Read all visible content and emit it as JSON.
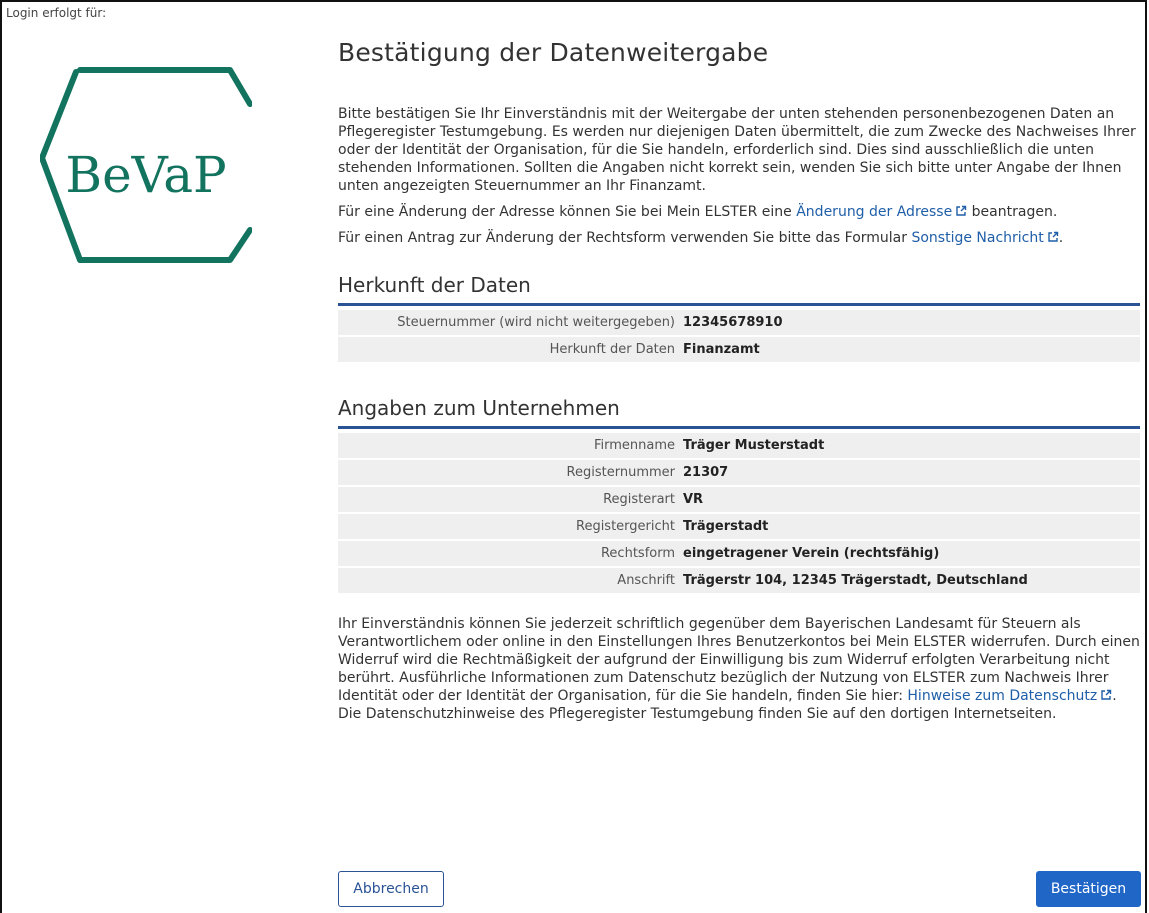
{
  "header": {
    "login_label": "Login erfolgt für:"
  },
  "logo": {
    "text": "BeVaP"
  },
  "page_title": "Bestätigung der Datenweitergabe",
  "intro": {
    "p1": "Bitte bestätigen Sie Ihr Einverständnis mit der Weitergabe der unten stehenden personenbezogenen Daten an Pflegeregister Testumgebung. Es werden nur diejenigen Daten übermittelt, die zum Zwecke des Nachweises Ihrer oder der Identität der Organisation, für die Sie handeln, erforderlich sind. Dies sind ausschließlich die unten stehenden Informationen. Sollten die Angaben nicht korrekt sein, wenden Sie sich bitte unter Angabe der Ihnen unten angezeigten Steuernummer an Ihr Finanzamt.",
    "p2_before": "Für eine Änderung der Adresse können Sie bei Mein ELSTER eine ",
    "p2_link": "Änderung der Adresse",
    "p2_after": " beantragen.",
    "p3_before": "Für einen Antrag zur Änderung der Rechtsform verwenden Sie bitte das Formular ",
    "p3_link": "Sonstige Nachricht",
    "p3_after": "."
  },
  "herkunft": {
    "title": "Herkunft der Daten",
    "rows": [
      {
        "label": "Steuernummer (wird nicht weitergegeben)",
        "value": "12345678910"
      },
      {
        "label": "Herkunft der Daten",
        "value": "Finanzamt"
      }
    ]
  },
  "unternehmen": {
    "title": "Angaben zum Unternehmen",
    "rows": [
      {
        "label": "Firmenname",
        "value": "Träger Musterstadt"
      },
      {
        "label": "Registernummer",
        "value": "21307"
      },
      {
        "label": "Registerart",
        "value": "VR"
      },
      {
        "label": "Registergericht",
        "value": "Trägerstadt"
      },
      {
        "label": "Rechtsform",
        "value": "eingetragener Verein (rechtsfähig)"
      },
      {
        "label": "Anschrift",
        "value": "Trägerstr 104, 12345 Trägerstadt, Deutschland"
      }
    ]
  },
  "footer_text": {
    "before": "Ihr Einverständnis können Sie jederzeit schriftlich gegenüber dem Bayerischen Landesamt für Steuern als Verantwortlichem oder online in den Einstellungen Ihres Benutzerkontos bei Mein ELSTER widerrufen. Durch einen Widerruf wird die Rechtmäßigkeit der aufgrund der Einwilligung bis zum Widerruf erfolgten Verarbeitung nicht berührt. Ausführliche Informationen zum Datenschutz bezüglich der Nutzung von ELSTER zum Nachweis Ihrer Identität oder der Identität der Organisation, für die Sie handeln, finden Sie hier: ",
    "link": "Hinweise zum Datenschutz",
    "after": ". Die Datenschutzhinweise des Pflegeregister Testumgebung finden Sie auf den dortigen Internetseiten."
  },
  "buttons": {
    "cancel": "Abbrechen",
    "confirm": "Bestätigen"
  },
  "colors": {
    "accent": "#2a5395",
    "logo_green": "#12735f",
    "link": "#1f5ea8",
    "primary_button": "#1f66c7"
  }
}
